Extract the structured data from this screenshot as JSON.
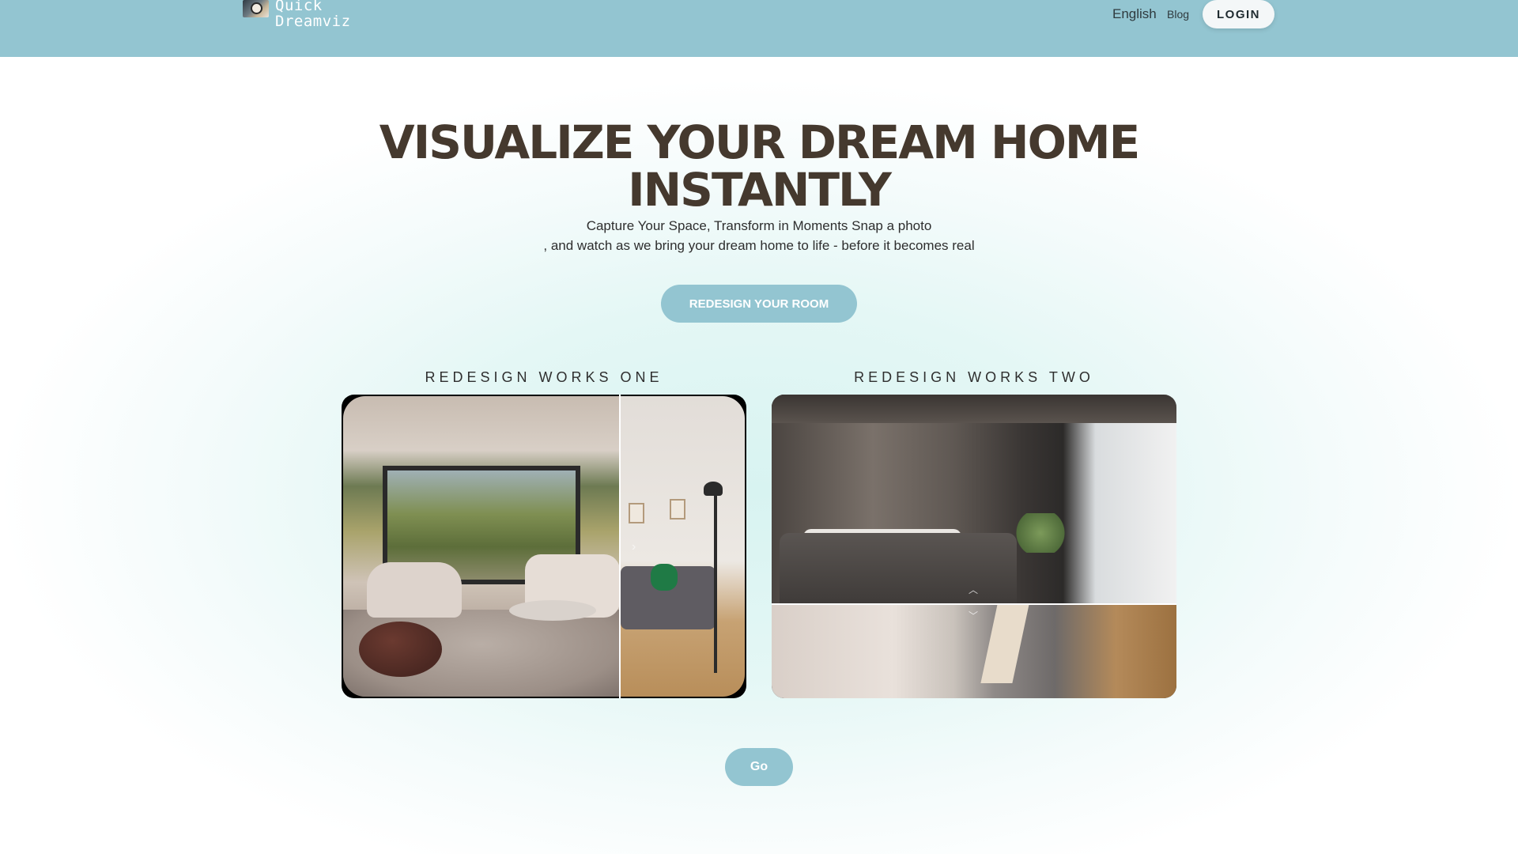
{
  "header": {
    "logo_line1": "Quick",
    "logo_line2": "Dreamviz",
    "language": "English",
    "blog": "Blog",
    "login": "LOGIN",
    "bar_color": "#93c5d1"
  },
  "hero": {
    "title": "VISUALIZE YOUR DREAM HOME INSTANTLY",
    "subtitle_line1": "Capture Your Space, Transform in Moments Snap a photo",
    "subtitle_line2": ", and watch as we bring your dream home to life - before it becomes real",
    "cta": "REDESIGN YOUR ROOM"
  },
  "works": [
    {
      "label": "REDESIGN WORKS ONE"
    },
    {
      "label": "REDESIGN WORKS TWO"
    }
  ],
  "icons": {
    "compare_handle": "chevron-right-icon",
    "up": "chevron-up-icon",
    "down": "chevron-down-icon"
  },
  "footer_button": "Go",
  "colors": {
    "accent": "#93c5d1",
    "title": "#45392e"
  }
}
